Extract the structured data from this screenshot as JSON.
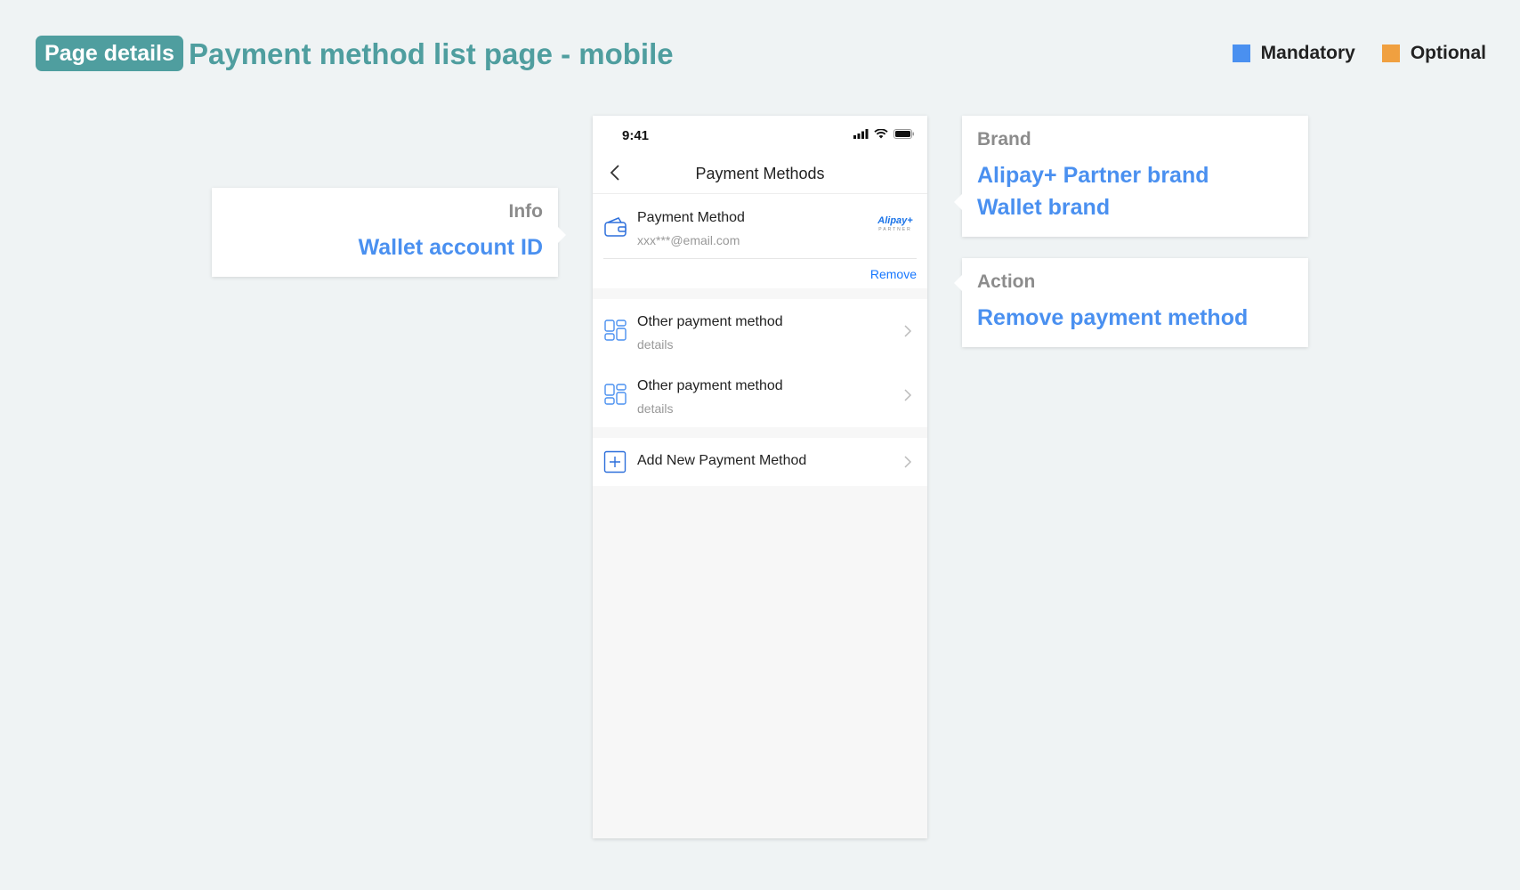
{
  "header": {
    "badge": "Page details",
    "title": "Payment method list page - mobile"
  },
  "legend": {
    "mandatory": {
      "label": "Mandatory",
      "color": "#4a90f0"
    },
    "optional": {
      "label": "Optional",
      "color": "#f0a040"
    }
  },
  "annotations": {
    "info": {
      "label": "Info",
      "value": "Wallet account ID"
    },
    "brand": {
      "label": "Brand",
      "values": [
        "Alipay+ Partner brand",
        "Wallet brand"
      ]
    },
    "action": {
      "label": "Action",
      "value": "Remove payment method"
    }
  },
  "phone": {
    "status_time": "9:41",
    "nav_title": "Payment Methods",
    "primary_method": {
      "name": "Payment Method",
      "account": "xxx***@email.com",
      "logo_text": "Alipay+",
      "logo_sub": "PARTNER",
      "remove_label": "Remove"
    },
    "other_methods": [
      {
        "name": "Other payment method",
        "sub": "details"
      },
      {
        "name": "Other payment method",
        "sub": "details"
      }
    ],
    "add_label": "Add New Payment Method"
  }
}
